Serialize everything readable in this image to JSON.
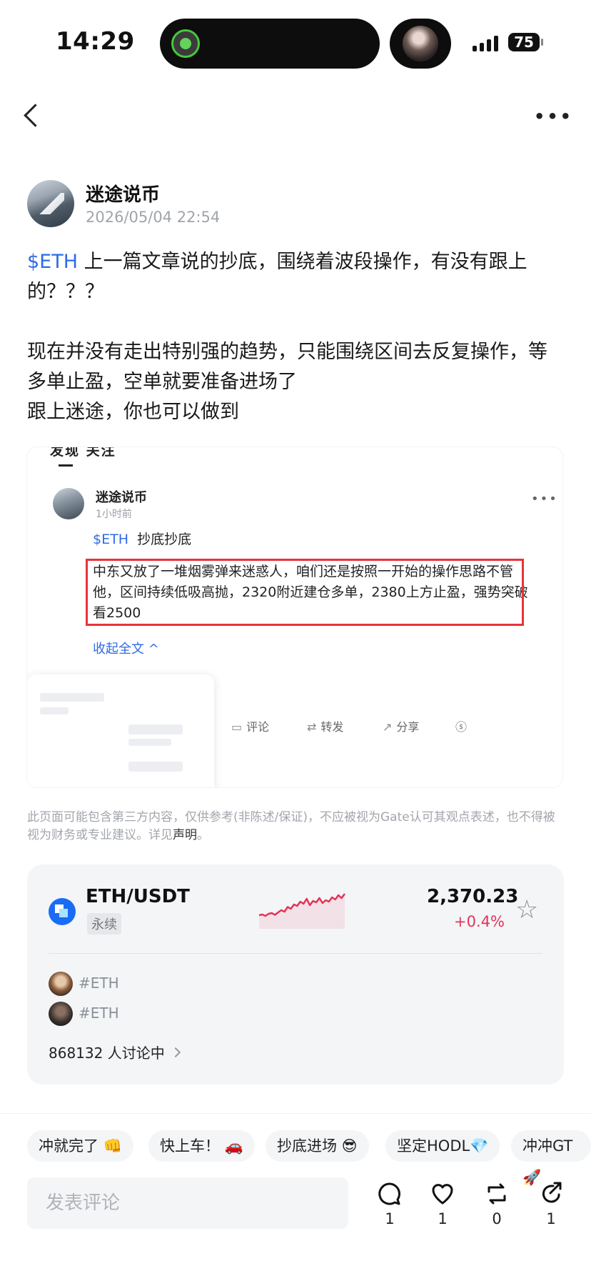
{
  "status_bar": {
    "time": "14:29",
    "battery": "75"
  },
  "author": {
    "name": "迷途说币",
    "date": "2026/05/04 22:54"
  },
  "post": {
    "tag": "$ETH",
    "line1_rest": " 上一篇文章说的抄底，围绕着波段操作，有没有跟上的？？？",
    "line2": "现在并没有走出特别强的趋势，只能围绕区间去反复操作，等多单止盈，空单就要准备进场了",
    "line3": "跟上迷途，你也可以做到"
  },
  "embedded": {
    "tabs": "发现  关注",
    "author": "迷途说币",
    "time": "1小时前",
    "tag": "$ETH",
    "title": "抄底抄底",
    "body": "中东又放了一堆烟雾弹来迷惑人，咱们还是按照一开始的操作思路不管他，区间持续低吸高抛，2320附近建仓多单，2380上方止盈，强势突破看2500",
    "collapse": "收起全文 ^",
    "actions": {
      "comment": "评论",
      "repost": "转发",
      "share": "分享"
    }
  },
  "disclaimer": {
    "text": "此页面可能包含第三方内容，仅供参考(非陈述/保证)，不应被视为Gate认可其观点表述，也不得被视为财务或专业建议。详见",
    "link": "声明",
    "end": "。"
  },
  "market": {
    "pair": "ETH/USDT",
    "type": "永续",
    "price": "2,370.23",
    "change": "+0.4%",
    "sparkline": [
      0.32,
      0.34,
      0.3,
      0.36,
      0.38,
      0.33,
      0.4,
      0.46,
      0.42,
      0.55,
      0.5,
      0.62,
      0.58,
      0.7,
      0.64,
      0.78,
      0.6,
      0.72,
      0.68,
      0.8,
      0.66,
      0.74,
      0.7,
      0.82,
      0.76,
      0.88,
      0.8,
      0.92
    ],
    "colors": {
      "up": "#e2335a",
      "coin": "#1a6cf5"
    }
  },
  "topics": [
    {
      "name": "#ETH"
    },
    {
      "name": "#ETH"
    }
  ],
  "discussion": {
    "count_text": "868132 人讨论中"
  },
  "chips": [
    "冲就完了 👊",
    "快上车！ 🚗",
    "抄底进场 😎",
    "坚定HODL💎",
    "冲冲GT 🚀"
  ],
  "comment_input": {
    "placeholder": "发表评论"
  },
  "counts": {
    "comment": "1",
    "like": "1",
    "repost": "0",
    "share": "1"
  }
}
